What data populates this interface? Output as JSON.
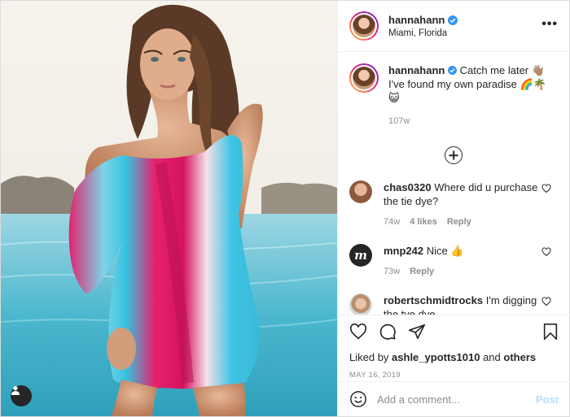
{
  "header": {
    "username": "hannahann",
    "location": "Miami, Florida"
  },
  "caption": {
    "username": "hannahann",
    "text": "Catch me later 👋🏽 I've found my own paradise 🌈🌴😺",
    "time": "107w"
  },
  "comments": [
    {
      "username": "chas0320",
      "text": "Where did u purchase the tie dye?",
      "time": "74w",
      "likes": "4 likes",
      "reply": "Reply"
    },
    {
      "username": "mnp242",
      "text": "Nice 👍",
      "time": "73w",
      "reply": "Reply"
    },
    {
      "username": "robertschmidtrocks",
      "text": "I'm digging the tye dye"
    }
  ],
  "likes": {
    "prefix": "Liked by",
    "user": "ashle_ypotts1010",
    "joiner": "and",
    "others": "others"
  },
  "date": "MAY 16, 2019",
  "add_comment": {
    "placeholder": "Add a comment...",
    "post_label": "Post"
  },
  "icons": {
    "verified": "verified-badge-icon",
    "more": "more-options-icon",
    "load_more": "plus-circle-icon",
    "like": "heart-icon",
    "comment": "comment-icon",
    "share": "paper-plane-icon",
    "save": "bookmark-icon",
    "emoji": "smiley-icon",
    "tag": "user-tag-icon"
  },
  "colors": {
    "accent": "#0095f6",
    "post_disabled": "#b2dffc",
    "muted_text": "#8e8e8e",
    "primary_text": "#262626"
  }
}
